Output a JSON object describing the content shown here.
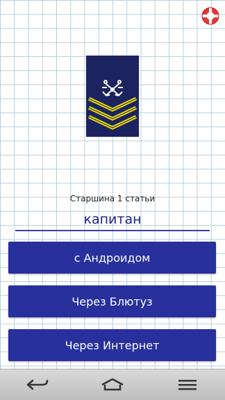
{
  "header": {
    "help_icon": "lifebuoy-icon"
  },
  "insignia": {
    "icon": "petty-officer-first-class-shoulder-board",
    "colors": {
      "board": "#1b2360",
      "stripes": "#f2e200",
      "anchors": "#ffffff"
    }
  },
  "rank_label": "Старшина 1 статьи",
  "name_field": {
    "value": "капитан"
  },
  "buttons": {
    "android": "с Андроидом",
    "bluetooth": "Через Блютуз",
    "internet": "Через Интернет"
  },
  "navbar": {
    "back_icon": "back-icon",
    "home_icon": "home-icon",
    "menu_icon": "menu-icon"
  },
  "colors": {
    "primary": "#27309c",
    "grid": "#b7cfe0",
    "help": "#e53935"
  }
}
